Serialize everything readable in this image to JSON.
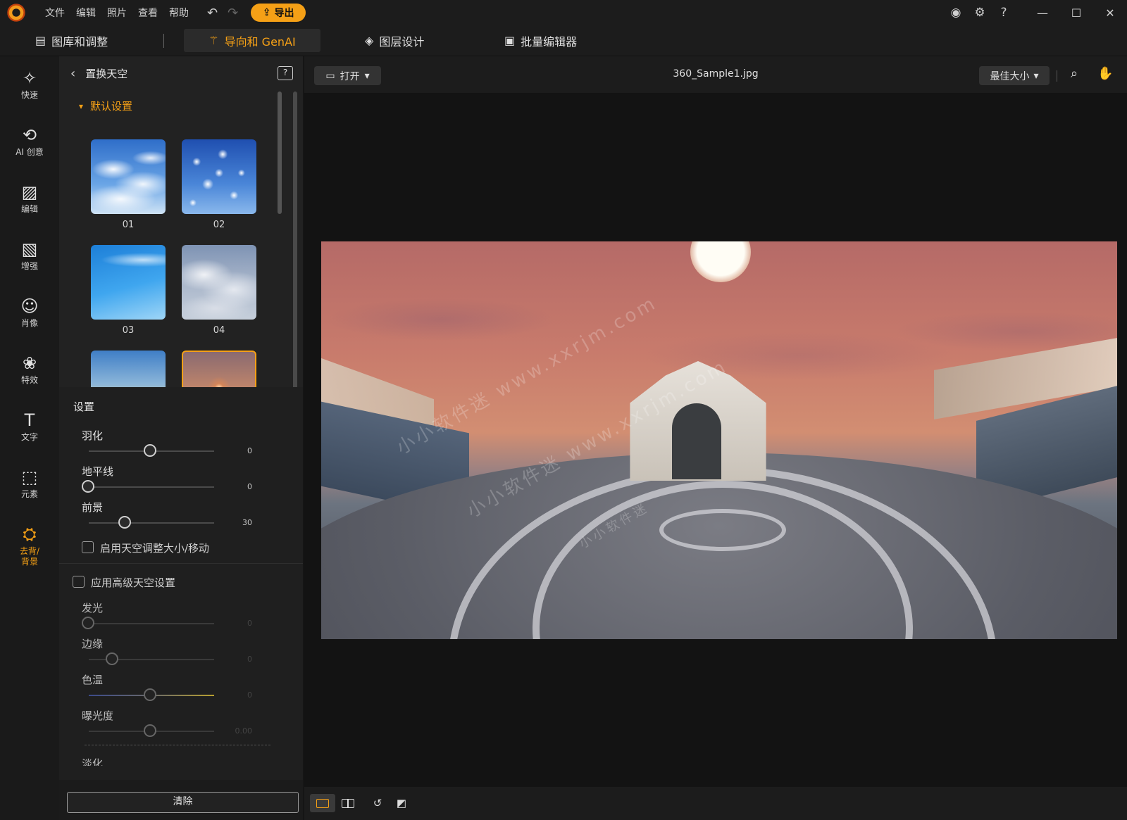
{
  "menu": {
    "items": [
      "文件",
      "编辑",
      "照片",
      "查看",
      "帮助"
    ],
    "export_label": "导出"
  },
  "tabs": [
    {
      "label": "图库和调整",
      "icon": "library-icon",
      "active": false
    },
    {
      "label": "导向和 GenAI",
      "icon": "magic-wand-icon",
      "active": true
    },
    {
      "label": "图层设计",
      "icon": "layers-icon",
      "active": false
    },
    {
      "label": "批量编辑器",
      "icon": "batch-images-icon",
      "active": false
    }
  ],
  "tools": [
    {
      "label": "快速",
      "icon": "quick-wand-icon"
    },
    {
      "label": "AI 创意",
      "icon": "ai-creative-icon"
    },
    {
      "label": "编辑",
      "icon": "edit-image-icon"
    },
    {
      "label": "增强",
      "icon": "enhance-icon"
    },
    {
      "label": "肖像",
      "icon": "portrait-icon"
    },
    {
      "label": "特效",
      "icon": "effects-icon"
    },
    {
      "label": "文字",
      "icon": "text-icon"
    },
    {
      "label": "元素",
      "icon": "elements-icon"
    },
    {
      "label": "去背/\n背景",
      "icon": "remove-background-icon",
      "active": true
    }
  ],
  "panel": {
    "title": "置换天空",
    "preset_group": "默认设置",
    "presets": [
      "01",
      "02",
      "03",
      "04",
      "",
      ""
    ],
    "selected_preset": 6,
    "settings_title": "设置",
    "sliders": [
      {
        "label": "羽化",
        "value": "0",
        "position": 0.5
      },
      {
        "label": "地平线",
        "value": "0",
        "position": 0.0
      },
      {
        "label": "前景",
        "value": "30",
        "position": 0.3
      }
    ],
    "sky_resize_checkbox": "启用天空调整大小/移动",
    "advanced_checkbox": "应用高级天空设置",
    "advanced_sliders": [
      {
        "label": "发光",
        "value": "0",
        "position": 0.0
      },
      {
        "label": "边缘",
        "value": "0",
        "position": 0.2
      },
      {
        "label": "色温",
        "value": "0",
        "position": 0.5
      },
      {
        "label": "曝光度",
        "value": "0.00",
        "position": 0.5
      }
    ],
    "cut_off_label": "淡化",
    "clear_button": "清除"
  },
  "canvas": {
    "open_button": "打开",
    "filename": "360_Sample1.jpg",
    "zoom_label": "最佳大小",
    "watermark": [
      "小小软件迷 www.xxrjm.com",
      "小小软件迷 www.xxrjm.com",
      "小小软件迷"
    ]
  },
  "colors": {
    "accent": "#f5a016",
    "background": "#151515",
    "panel": "#222222"
  }
}
